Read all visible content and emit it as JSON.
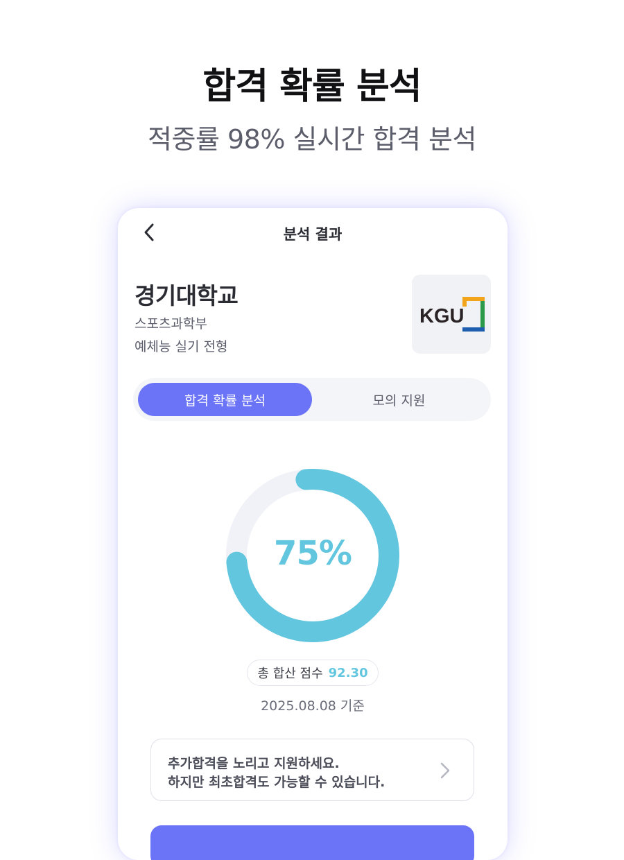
{
  "hero": {
    "title": "합격 확률 분석",
    "subtitle": "적중률 98% 실시간 합격 분석"
  },
  "header": {
    "title": "분석 결과",
    "back_icon": "chevron-left-icon"
  },
  "school": {
    "name": "경기대학교",
    "department": "스포츠과학부",
    "track": "예체능 실기 전형",
    "logo_text": "KGU"
  },
  "tabs": [
    {
      "label": "합격 확률 분석",
      "active": true
    },
    {
      "label": "모의 지원",
      "active": false
    }
  ],
  "result": {
    "probability_label": "75%",
    "probability": 0.75,
    "score_label": "총 합산 점수",
    "score_value": "92.30",
    "date": "2025.08.08 기준"
  },
  "tip": {
    "line1": "추가합격을 노리고 지원하세요.",
    "line2": "하지만 최초합격도 가능할 수 있습니다.",
    "arrow_icon": "chevron-right-icon"
  },
  "colors": {
    "accent": "#6b74f6",
    "gauge": "#63c6df",
    "gauge_track": "#f1f2f7"
  }
}
